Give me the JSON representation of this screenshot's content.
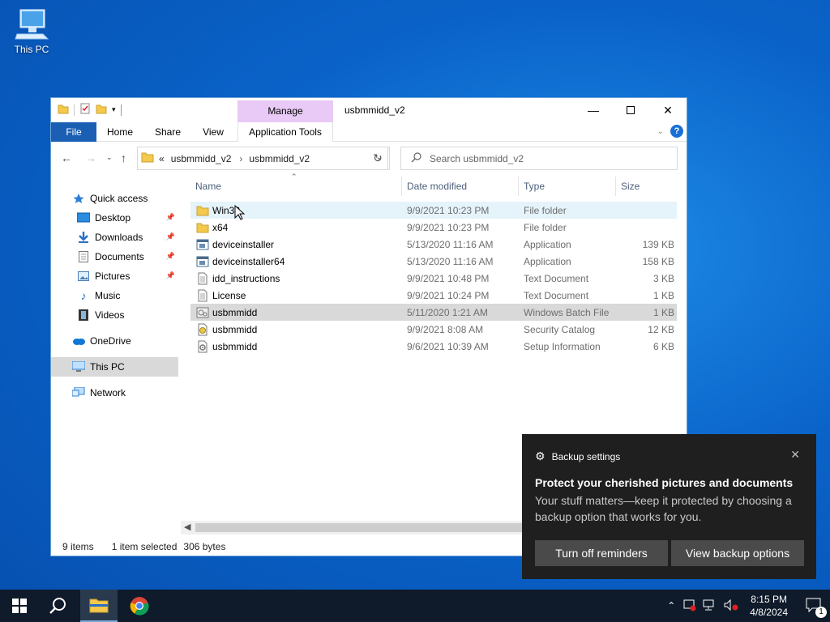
{
  "desktop": {
    "this_pc_label": "This PC"
  },
  "window": {
    "title": "usbmmidd_v2",
    "context_tab": "Manage",
    "ribbon_tabs": [
      "File",
      "Home",
      "Share",
      "View",
      "Application Tools"
    ],
    "address": {
      "crumb1": "usbmmidd_v2",
      "crumb2": "usbmmidd_v2",
      "prefix": "«"
    },
    "search_placeholder": "Search usbmmidd_v2",
    "columns": {
      "name": "Name",
      "date": "Date modified",
      "type": "Type",
      "size": "Size"
    }
  },
  "sidebar": {
    "quick_access": "Quick access",
    "desktop": "Desktop",
    "downloads": "Downloads",
    "documents": "Documents",
    "pictures": "Pictures",
    "music": "Music",
    "videos": "Videos",
    "onedrive": "OneDrive",
    "this_pc": "This PC",
    "network": "Network"
  },
  "files": [
    {
      "name": "Win32",
      "date": "9/9/2021 10:23 PM",
      "type": "File folder",
      "size": "",
      "icon": "folder-icon"
    },
    {
      "name": "x64",
      "date": "9/9/2021 10:23 PM",
      "type": "File folder",
      "size": "",
      "icon": "folder-icon"
    },
    {
      "name": "deviceinstaller",
      "date": "5/13/2020 11:16 AM",
      "type": "Application",
      "size": "139 KB",
      "icon": "application-icon"
    },
    {
      "name": "deviceinstaller64",
      "date": "5/13/2020 11:16 AM",
      "type": "Application",
      "size": "158 KB",
      "icon": "application-icon"
    },
    {
      "name": "idd_instructions",
      "date": "9/9/2021 10:48 PM",
      "type": "Text Document",
      "size": "3 KB",
      "icon": "text-document-icon"
    },
    {
      "name": "License",
      "date": "9/9/2021 10:24 PM",
      "type": "Text Document",
      "size": "1 KB",
      "icon": "text-document-icon"
    },
    {
      "name": "usbmmidd",
      "date": "5/11/2020 1:21 AM",
      "type": "Windows Batch File",
      "size": "1 KB",
      "icon": "batch-file-icon"
    },
    {
      "name": "usbmmidd",
      "date": "9/9/2021 8:08 AM",
      "type": "Security Catalog",
      "size": "12 KB",
      "icon": "security-catalog-icon"
    },
    {
      "name": "usbmmidd",
      "date": "9/6/2021 10:39 AM",
      "type": "Setup Information",
      "size": "6 KB",
      "icon": "setup-information-icon"
    }
  ],
  "status": {
    "items": "9 items",
    "selected": "1 item selected",
    "bytes": "306 bytes"
  },
  "toast": {
    "app": "Backup settings",
    "title": "Protect your cherished pictures and documents",
    "body": "Your stuff matters—keep it protected by choosing a backup option that works for you.",
    "btn_left": "Turn off reminders",
    "btn_right": "View backup options"
  },
  "taskbar": {
    "time": "8:15 PM",
    "date": "4/8/2024",
    "notif_count": "1"
  },
  "colors": {
    "accent": "#1a5fb4",
    "selected_row": "#d9d9d9",
    "hover_row": "#e5f3fb",
    "manage_tab": "#e9c9f5"
  }
}
